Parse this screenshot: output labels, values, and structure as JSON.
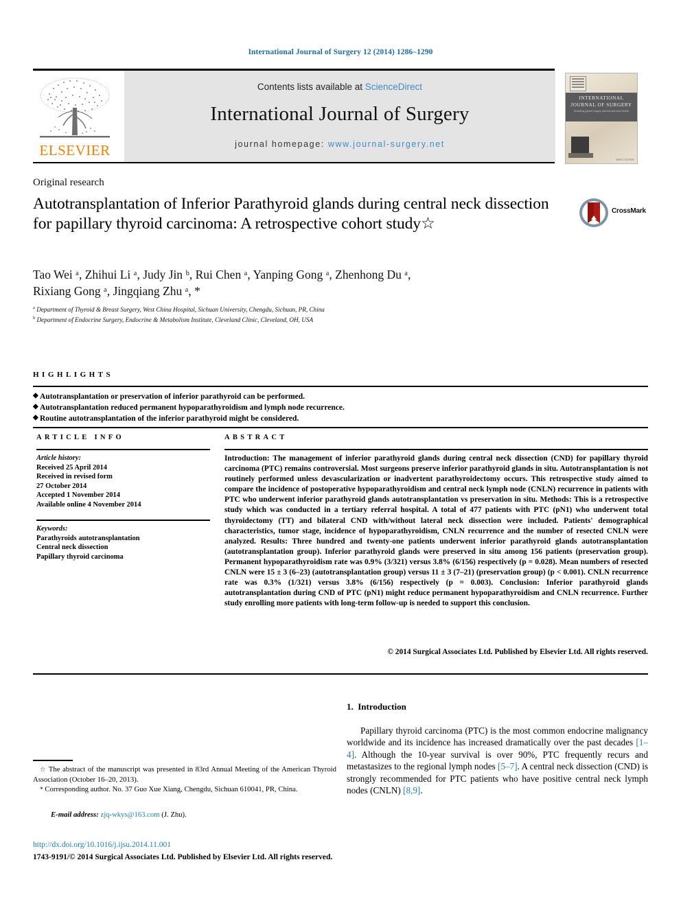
{
  "running_head": "International Journal of Surgery 12 (2014) 1286–1290",
  "masthead": {
    "contents_prefix": "Contents lists available at",
    "sciencedirect": "ScienceDirect",
    "journal_title": "International Journal of Surgery",
    "homepage_prefix": "journal homepage:",
    "homepage_url": "www.journal-surgery.net",
    "publisher_wordmark": "ELSEVIER",
    "cover": {
      "line1": "INTERNATIONAL",
      "line2": "JOURNAL OF SURGERY",
      "line3": "Including global surgery and international health",
      "issn": "ISSN 1743-9191"
    },
    "link_color": "#3c8dc5",
    "brand_orange": "#f08000"
  },
  "article": {
    "category": "Original research",
    "title": "Autotransplantation of Inferior Parathyroid glands during central neck dissection for papillary thyroid carcinoma: A retrospective cohort study",
    "title_marker": "☆",
    "crossmark_label": "CrossMark",
    "authors_line1": "Tao Wei ᵃ, Zhihui Li ᵃ, Judy Jin ᵇ, Rui Chen ᵃ, Yanping Gong ᵃ, Zhenhong Du ᵃ,",
    "authors_line2": "Rixiang Gong ᵃ, Jingqiang Zhu ᵃ, *",
    "affiliations": [
      "Department of Thyroid & Breast Surgery, West China Hospital, Sichuan University, Chengdu, Sichuan, PR, China",
      "Department of Endocrine Surgery, Endocrine & Metabolism Institute, Cleveland Clinic, Cleveland, OH, USA"
    ],
    "affiliation_marks": [
      "a",
      "b"
    ]
  },
  "highlights": {
    "heading": "HIGHLIGHTS",
    "items": [
      "Autotransplantation or preservation of inferior parathyroid can be performed.",
      "Autotransplantation reduced permanent hypoparathyroidism and lymph node recurrence.",
      "Routine autotransplantation of the inferior parathyroid might be considered."
    ]
  },
  "article_info": {
    "heading": "ARTICLE INFO",
    "history_label": "Article history:",
    "history": [
      "Received 25 April 2014",
      "Received in revised form",
      "27 October 2014",
      "Accepted 1 November 2014",
      "Available online 4 November 2014"
    ],
    "keywords_label": "Keywords:",
    "keywords": [
      "Parathyroids autotransplantation",
      "Central neck dissection",
      "Papillary thyroid carcinoma"
    ]
  },
  "abstract": {
    "heading": "ABSTRACT",
    "introduction_label": "Introduction:",
    "introduction_text": " The management of inferior parathyroid glands during central neck dissection (CND) for papillary thyroid carcinoma (PTC) remains controversial. Most surgeons preserve inferior parathyroid glands in situ. Autotransplantation is not routinely performed unless devascularization or inadvertent parathyroidectomy occurs. This retrospective study aimed to compare the incidence of postoperative hypoparathyroidism and central neck lymph node (CNLN) recurrence in patients with PTC who underwent inferior parathyroid glands autotransplantation vs preservation in situ. ",
    "methods_label": "Methods:",
    "methods_text": " This is a retrospective study which was conducted in a tertiary referral hospital. A total of 477 patients with PTC (pN1) who underwent total thyroidectomy (TT) and bilateral CND with/without lateral neck dissection were included. Patients' demographical characteristics, tumor stage, incidence of hypoparathyroidism, CNLN recurrence and the number of resected CNLN were analyzed. ",
    "results_label": "Results:",
    "results_text": " Three hundred and twenty-one patients underwent inferior parathyroid glands autotransplantation (autotransplantation group). Inferior parathyroid glands were preserved in situ among 156 patients (preservation group). Permanent hypoparathyroidism rate was 0.9% (3/321) versus 3.8% (6/156) respectively (p = 0.028). Mean numbers of resected CNLN were 15 ± 3 (6–23) (autotransplantation group) versus 11 ± 3 (7–21) (preservation group) (p < 0.001). CNLN recurrence rate was 0.3% (1/321) versus 3.8% (6/156) respectively (p = 0.003). ",
    "conclusion_label": "Conclusion:",
    "conclusion_text": " Inferior parathyroid glands autotransplantation during CND of PTC (pN1) might reduce permanent hypoparathyroidism and CNLN recurrence. Further study enrolling more patients with long-term follow-up is needed to support this conclusion.",
    "copyright": "© 2014 Surgical Associates Ltd. Published by Elsevier Ltd. All rights reserved."
  },
  "body": {
    "section_number": "1.",
    "section_title": "Introduction",
    "paragraph_part1": "Papillary thyroid carcinoma (PTC) is the most common endocrine malignancy worldwide and its incidence has increased dramatically over the past decades ",
    "ref1": "[1–4]",
    "paragraph_part2": ". Although the 10-year survival is over 90%, PTC frequently recurs and metastasizes to the regional lymph nodes ",
    "ref2": "[5–7]",
    "paragraph_part3": ". A central neck dissection (CND) is strongly recommended for PTC patients who have positive central neck lymph nodes (CNLN) ",
    "ref3": "[8,9]",
    "paragraph_part4": "."
  },
  "footnotes": {
    "note1_marker": "☆",
    "note1": " The abstract of the manuscript was presented in 83rd Annual Meeting of the American Thyroid Association (October 16–20, 2013).",
    "note2_marker": "*",
    "note2": " Corresponding author. No. 37 Guo Xue Xiang, Chengdu, Sichuan 610041, PR, China.",
    "email_label": "E-mail address:",
    "email": "zjq-wkys@163.com",
    "email_suffix": "(J. Zhu)."
  },
  "footer": {
    "doi": "http://dx.doi.org/10.1016/j.ijsu.2014.11.001",
    "imprint": "1743-9191/© 2014 Surgical Associates Ltd. Published by Elsevier Ltd. All rights reserved."
  }
}
